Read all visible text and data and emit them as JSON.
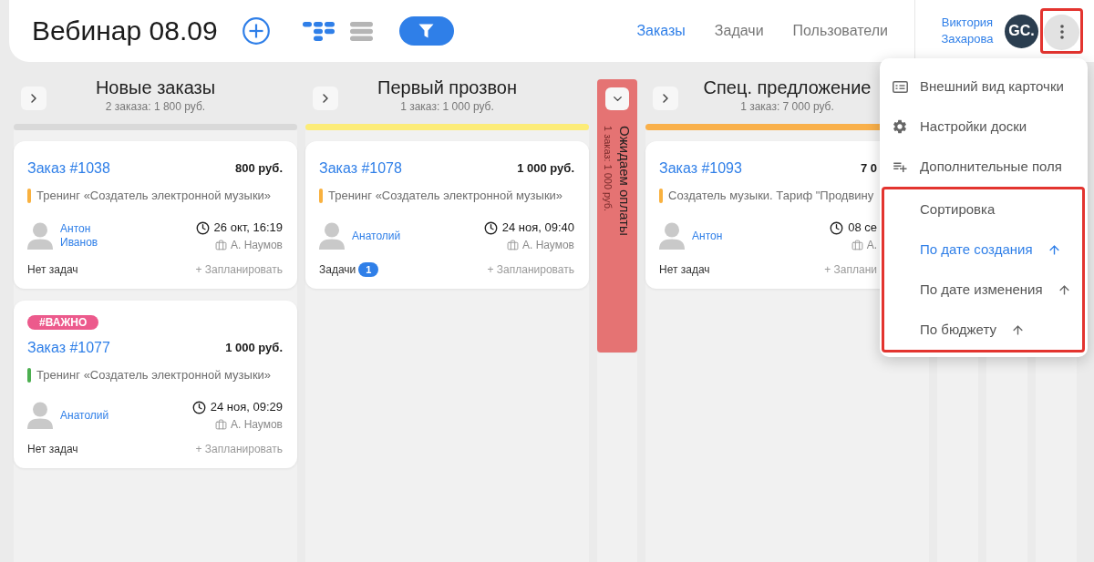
{
  "header": {
    "title": "Вебинар 08.09",
    "views": [
      {
        "kind": "board",
        "selected": true
      },
      {
        "kind": "list",
        "selected": false
      }
    ],
    "filter": {
      "active": true
    },
    "nav": [
      {
        "label": "Заказы",
        "selected": true
      },
      {
        "label": "Задачи",
        "selected": false
      },
      {
        "label": "Пользователи",
        "selected": false
      }
    ],
    "user": {
      "name": "Виктория Захарова",
      "avatar": "GC."
    },
    "menu_button": {
      "highlighted": true
    }
  },
  "columns": [
    {
      "kind": "open",
      "title": "Новые заказы",
      "summary": "2 заказа: 1 800 руб.",
      "color": "#d9d9d9",
      "cards": [
        {
          "title": "Заказ #1038",
          "price": "800 руб.",
          "product": {
            "label": "Тренинг «Создатель электронной музыки»",
            "color": "#f9b13f"
          },
          "assignee": "Антон Иванов",
          "date": "26 окт, 16:19",
          "manager": "А. Наумов",
          "tasks": "Нет задач",
          "schedule": "+ Запланировать"
        },
        {
          "tag": "#ВАЖНО",
          "title": "Заказ #1077",
          "price": "1 000 руб.",
          "product": {
            "label": "Тренинг «Создатель электронной музыки»",
            "color": "#4caf50"
          },
          "assignee": "Анатолий",
          "date": "24 ноя, 09:29",
          "manager": "А. Наумов",
          "tasks": "Нет задач",
          "schedule": "+ Запланировать"
        }
      ]
    },
    {
      "kind": "open",
      "title": "Первый прозвон",
      "summary": "1 заказ: 1 000 руб.",
      "color": "#fcec78",
      "cards": [
        {
          "title": "Заказ #1078",
          "price": "1 000 руб.",
          "product": {
            "label": "Тренинг «Создатель электронной музыки»",
            "color": "#f9b13f"
          },
          "assignee": "Анатолий",
          "date": "24 ноя, 09:40",
          "manager": "А. Наумов",
          "tasks": "Задачи",
          "task_count": "1",
          "schedule": "+ Запланировать"
        }
      ]
    },
    {
      "kind": "collapsed",
      "title": "Ожидаем оплаты",
      "summary": "1 заказ: 1 000 руб.",
      "color": "#e57373"
    },
    {
      "kind": "cut",
      "title": "Спец. предложение",
      "summary": "1 заказ: 7 000 руб.",
      "color": "#f9b04a",
      "cards": [
        {
          "title": "Заказ #1093",
          "price": "7 0",
          "product": {
            "label": "Создатель музыки. Тариф \"Продвину",
            "color": "#f9b13f"
          },
          "assignee": "Антон",
          "date": "08 се",
          "manager": "А.",
          "tasks": "Нет задач",
          "schedule": "+ Заплани"
        }
      ]
    },
    {
      "kind": "strip"
    },
    {
      "kind": "strip"
    },
    {
      "kind": "strip"
    }
  ],
  "menu": {
    "items": [
      {
        "kind": "appearance",
        "label": "Внешний вид карточки"
      },
      {
        "kind": "settings",
        "label": "Настройки доски"
      },
      {
        "kind": "fields",
        "label": "Дополнительные поля"
      }
    ],
    "sort": {
      "highlighted": true,
      "label": "Сортировка",
      "options": [
        {
          "label": "По дате создания",
          "selected": true
        },
        {
          "label": "По дате изменения",
          "selected": false
        },
        {
          "label": "По бюджету",
          "selected": false
        }
      ]
    }
  }
}
